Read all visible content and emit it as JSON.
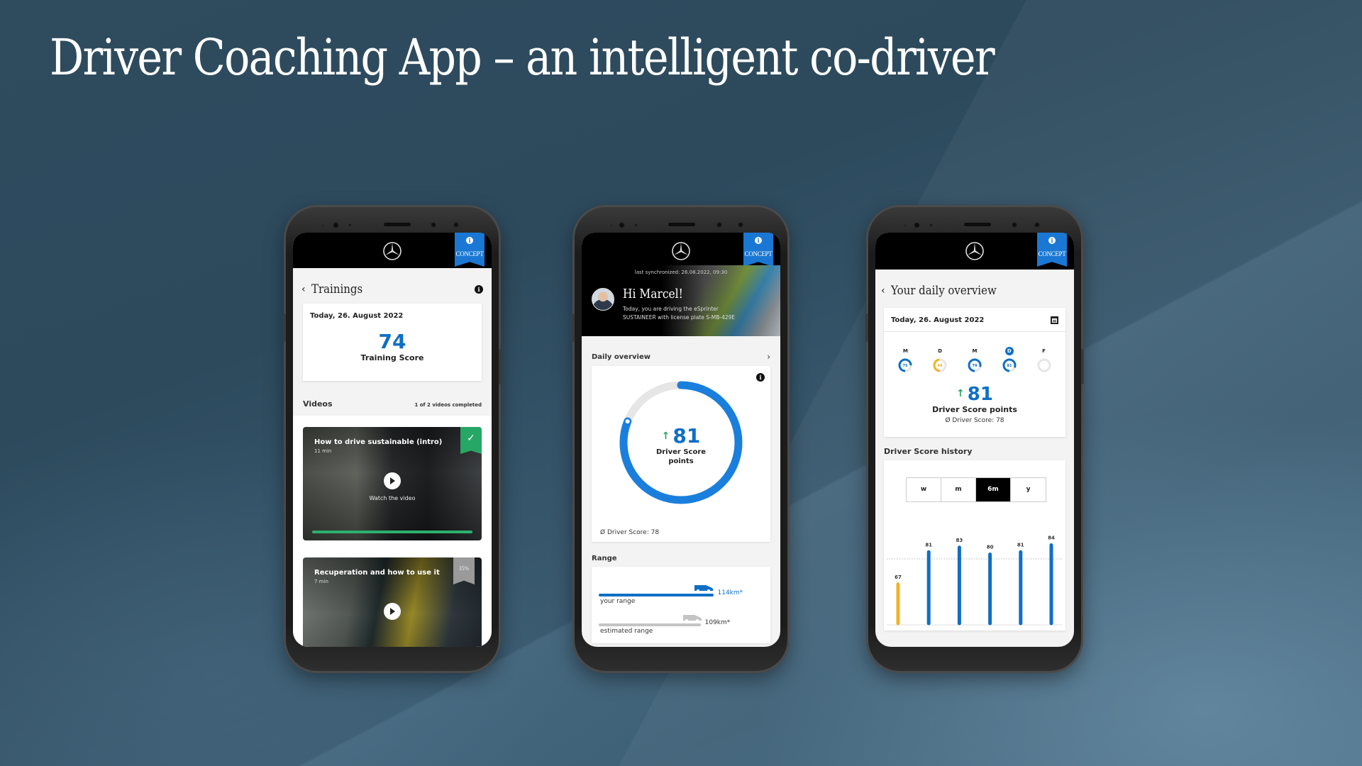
{
  "slide": {
    "title": "Driver Coaching App – an intelligent co-driver"
  },
  "common": {
    "concept_label": "CONCEPT",
    "info_glyph": "i",
    "back_glyph": "‹",
    "forward_glyph": "›"
  },
  "phone1": {
    "page_title": "Trainings",
    "date": "Today, 26. August 2022",
    "training_score": "74",
    "training_score_label": "Training Score",
    "videos_heading": "Videos",
    "videos_progress": "1 of 2 videos completed",
    "videos": [
      {
        "title": "How to drive sustainable (intro)",
        "duration": "11 min",
        "cta": "Watch the video",
        "status": "completed",
        "progress": 1.0,
        "badge": "✓"
      },
      {
        "title": "Recuperation and how to use it",
        "duration": "7 min",
        "status": "in-progress",
        "progress": 0.35,
        "badge": "35%"
      }
    ]
  },
  "phone2": {
    "sync_text": "last synchronized: 26.08.2022, 09:30",
    "greeting": "Hi Marcel!",
    "vehicle_line1": "Today, you are driving the eSprinter",
    "vehicle_line2": "SUSTAINEER with license plate S-MB-429E",
    "overview_title": "Daily overview",
    "score": "81",
    "score_trend": "↑",
    "score_label_line1": "Driver Score",
    "score_label_line2": "points",
    "score_fraction": 0.81,
    "avg_score": "Ø Driver Score: 78",
    "range_title": "Range",
    "your_range_label": "your range",
    "your_range_value": "114km*",
    "your_range_km": 114,
    "estimated_range_label": "estimated range",
    "estimated_range_value": "109km*",
    "estimated_range_km": 109,
    "colors": {
      "accent": "#0f6fc6",
      "track": "#e6e6e6",
      "trend": "#27a765"
    }
  },
  "phone3": {
    "page_title": "Your daily overview",
    "date": "Today, 26. August 2022",
    "days": [
      {
        "letter": "M",
        "value": "75",
        "score": 75,
        "color": "#0f6fc6",
        "active": false
      },
      {
        "letter": "D",
        "value": "48",
        "score": 48,
        "color": "#f0b323",
        "active": false
      },
      {
        "letter": "M",
        "value": "79",
        "score": 79,
        "color": "#0f6fc6",
        "active": false
      },
      {
        "letter": "D",
        "value": "81",
        "score": 81,
        "color": "#0f6fc6",
        "active": true
      },
      {
        "letter": "F",
        "value": "",
        "score": 0,
        "color": "#e6e6e6",
        "active": false
      }
    ],
    "score": "81",
    "score_trend": "↑",
    "score_label": "Driver Score points",
    "avg_score": "Ø Driver Score: 78",
    "history_title": "Driver Score history",
    "periods": [
      {
        "label": "w",
        "active": false
      },
      {
        "label": "m",
        "active": false
      },
      {
        "label": "6m",
        "active": true
      },
      {
        "label": "y",
        "active": false
      }
    ]
  },
  "chart_data": {
    "type": "bar",
    "title": "Driver Score history",
    "categories": [
      "",
      "",
      "",
      "",
      "",
      ""
    ],
    "values": [
      67,
      81,
      83,
      80,
      81,
      84
    ],
    "bar_colors": [
      "#f0b323",
      "#0f6fc6",
      "#0f6fc6",
      "#0f6fc6",
      "#0f6fc6",
      "#0f6fc6"
    ],
    "reference_line": 78,
    "reference_style": "dotted",
    "ylim": [
      0,
      90
    ],
    "xlabel": "",
    "ylabel": "",
    "grid": false,
    "legend": "none"
  }
}
